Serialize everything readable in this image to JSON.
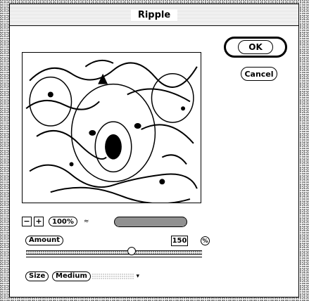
{
  "dialog": {
    "title": "Ripple"
  },
  "buttons": {
    "ok": "OK",
    "cancel": "Cancel"
  },
  "zoom": {
    "minus": "−",
    "plus": "+",
    "percent": "100%",
    "caret": "≈"
  },
  "progress": {
    "fraction": 1.0
  },
  "amount": {
    "label": "Amount",
    "value": "150",
    "unit": "%",
    "slider_fraction": 0.6
  },
  "size": {
    "label": "Size",
    "selected": "Medium",
    "arrow": "▾"
  },
  "icons": [
    "zoom-out-icon",
    "zoom-in-icon",
    "percent-icon",
    "dropdown-arrow-icon"
  ]
}
